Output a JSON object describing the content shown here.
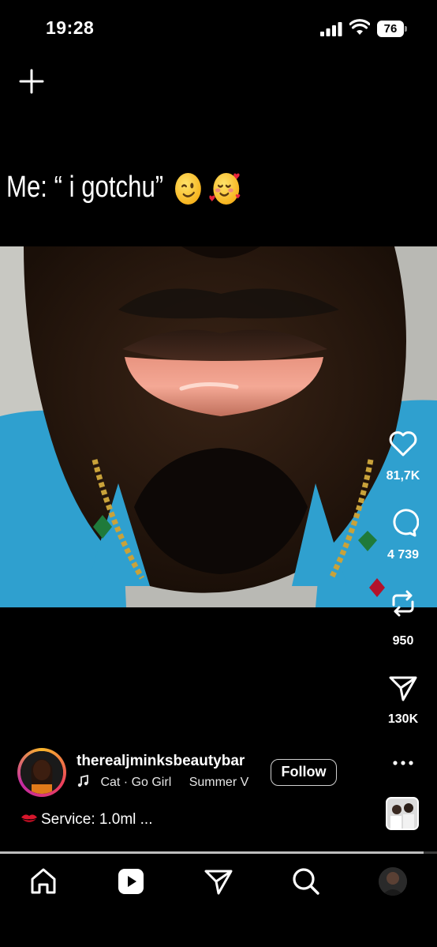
{
  "status_bar": {
    "time": "19:28",
    "battery": "76"
  },
  "caption": {
    "text": "Me: “ i gotchu”"
  },
  "actions": {
    "likes": "81,7K",
    "comments": "4 739",
    "reposts": "950",
    "shares": "130K"
  },
  "author": {
    "username": "therealjminksbeautybar",
    "music": "Cat · Go Girl",
    "music_next": "Summer V",
    "follow_label": "Follow"
  },
  "description": {
    "text": "Service: 1.0ml ..."
  },
  "progress": {
    "fraction": 0.97
  },
  "icons": [
    "plus-icon",
    "heart-icon",
    "comment-icon",
    "repost-icon",
    "share-icon",
    "more-icon",
    "home-icon",
    "reels-icon",
    "send-icon",
    "search-icon",
    "music-note-icon"
  ]
}
